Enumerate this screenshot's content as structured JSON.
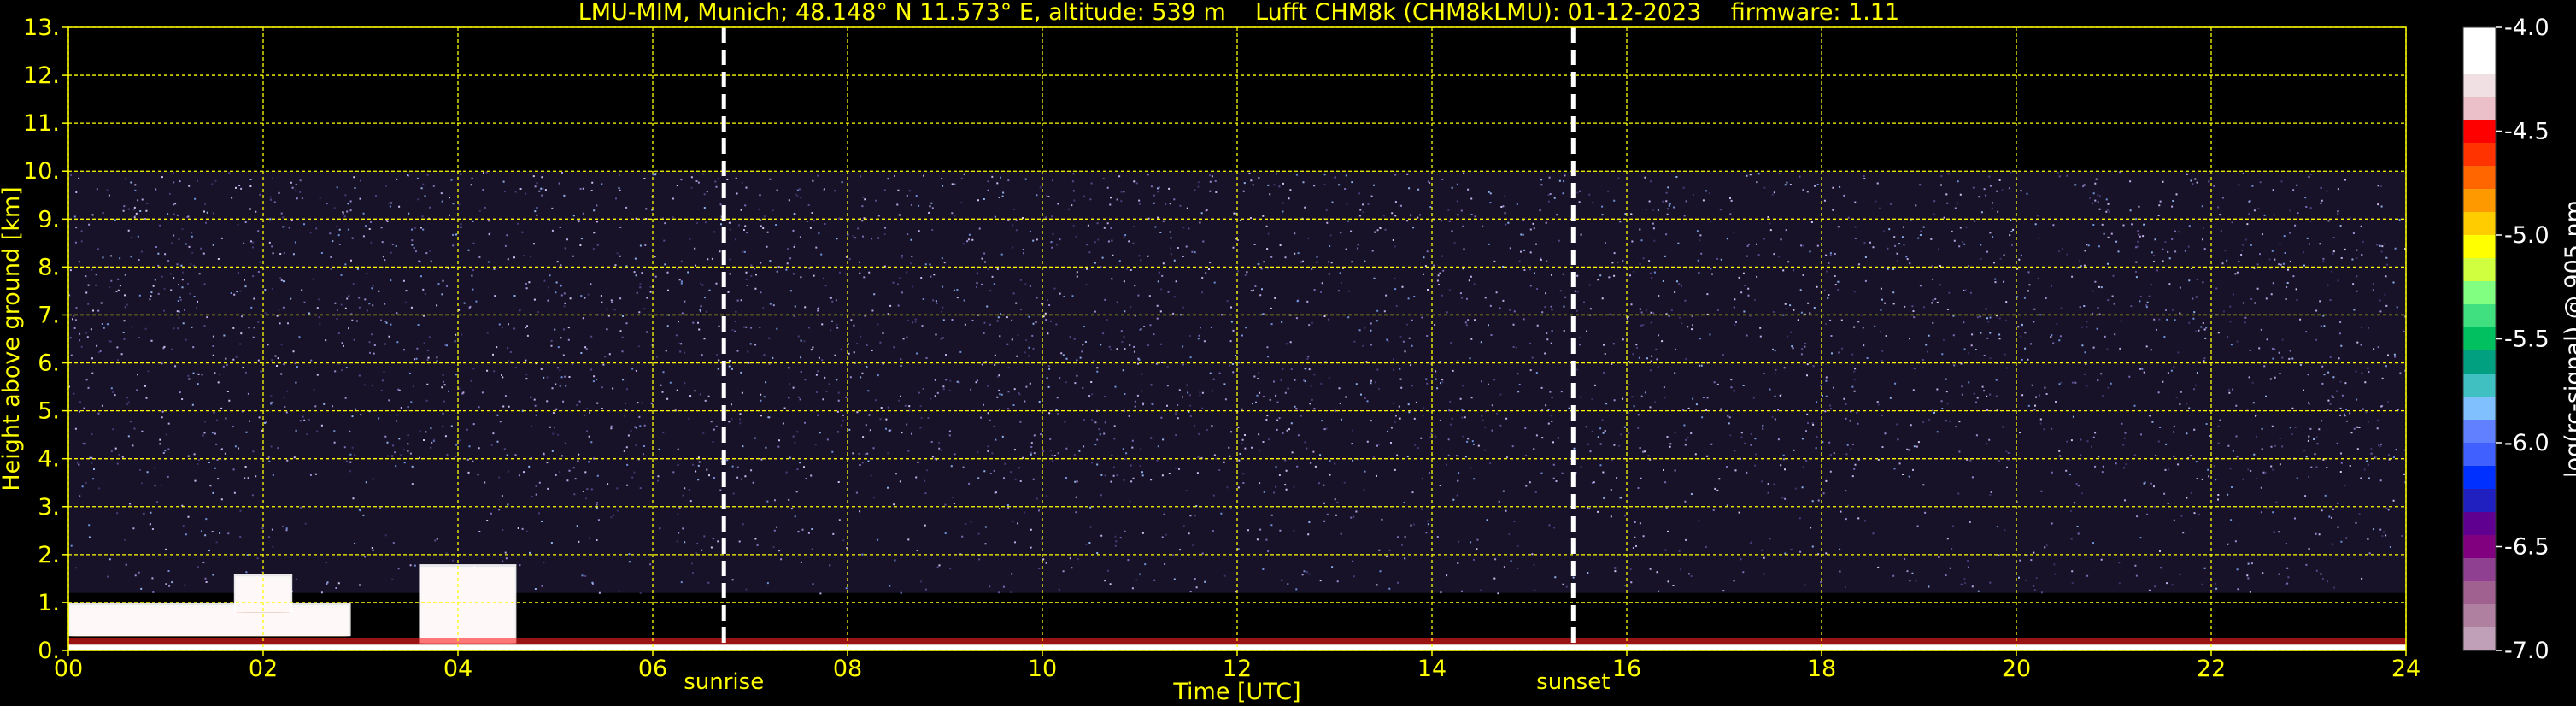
{
  "chart_data": {
    "type": "heatmap",
    "title": "LMU-MIM, Munich; 48.148° N 11.573° E, altitude: 539 m    Lufft CHM8k (CHM8kLMU): 01-12-2023    firmware: 1.11",
    "xlabel": "Time [UTC]",
    "ylabel": "Height above ground [km]",
    "xlim": [
      0,
      24
    ],
    "ylim": [
      0,
      13
    ],
    "x_ticks": [
      "00",
      "02",
      "04",
      "06",
      "08",
      "10",
      "12",
      "14",
      "16",
      "18",
      "20",
      "22",
      "24"
    ],
    "y_ticks": [
      "0.",
      "1.",
      "2.",
      "3.",
      "4.",
      "5.",
      "6.",
      "7.",
      "8.",
      "9.",
      "10.",
      "11.",
      "12.",
      "13."
    ],
    "grid": true,
    "vlines": [
      {
        "x": 6.73,
        "label": "sunrise"
      },
      {
        "x": 15.45,
        "label": "sunset"
      }
    ],
    "signal_top_km": 10,
    "colorbar": {
      "label": "log(rc-signal) @ 905 nm",
      "ticks": [
        "-4.0",
        "-4.5",
        "-5.0",
        "-5.5",
        "-6.0",
        "-6.5",
        "-7.0"
      ],
      "range": [
        -7.0,
        -4.0
      ]
    },
    "cloud_layers": [
      {
        "t0": 0.0,
        "t1": 2.9,
        "top_km": 1.0,
        "base_km": 0.3
      },
      {
        "t0": 3.6,
        "t1": 4.6,
        "top_km": 1.8,
        "base_km": 0.15
      },
      {
        "t0": 1.7,
        "t1": 2.3,
        "top_km": 1.6,
        "base_km": 0.8
      }
    ]
  },
  "colors": {
    "background": "#000000",
    "text": "#ffff00",
    "grid": "#ffff00",
    "vline": "#ffffff"
  }
}
